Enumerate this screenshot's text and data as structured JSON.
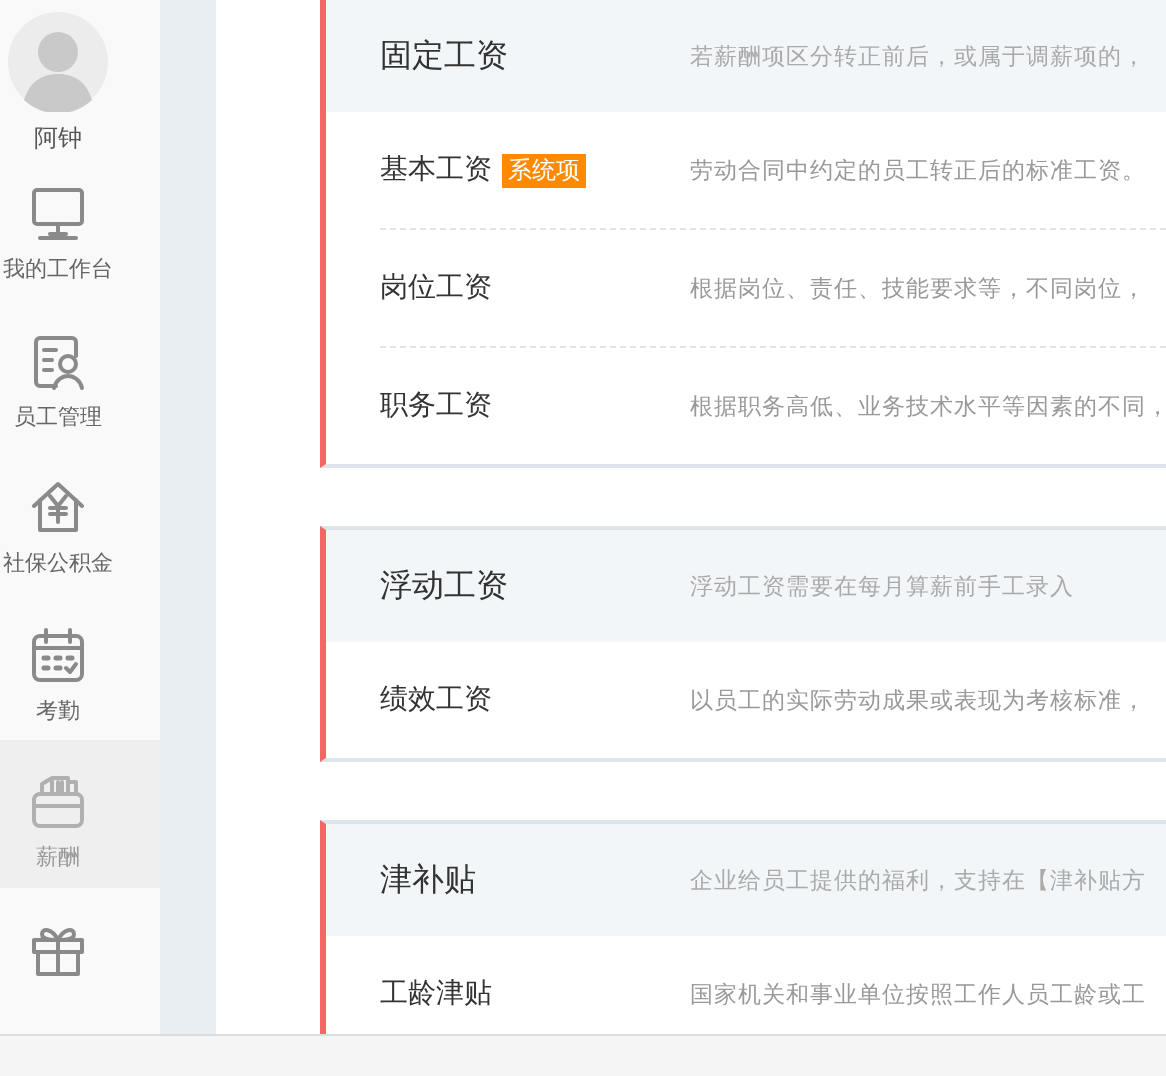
{
  "user": {
    "name": "阿钟"
  },
  "sidebar": {
    "items": [
      {
        "label": "我的工作台",
        "selected": false
      },
      {
        "label": "员工管理",
        "selected": false
      },
      {
        "label": "社保公积金",
        "selected": false
      },
      {
        "label": "考勤",
        "selected": false
      },
      {
        "label": "薪酬",
        "selected": true
      },
      {
        "selected": false
      }
    ]
  },
  "sections": [
    {
      "title": "固定工资",
      "description": "若薪酬项区分转正前后，或属于调薪项的，",
      "items": [
        {
          "name": "基本工资",
          "badge": "系统项",
          "description": "劳动合同中约定的员工转正后的标准工资。"
        },
        {
          "name": "岗位工资",
          "description": "根据岗位、责任、技能要求等，不同岗位，"
        },
        {
          "name": "职务工资",
          "description": "根据职务高低、业务技术水平等因素的不同，"
        }
      ]
    },
    {
      "title": "浮动工资",
      "description": "浮动工资需要在每月算薪前手工录入",
      "items": [
        {
          "name": "绩效工资",
          "description": "以员工的实际劳动成果或表现为考核标准，"
        }
      ]
    },
    {
      "title": "津补贴",
      "description": "企业给员工提供的福利，支持在【津补贴方",
      "items": [
        {
          "name": "工龄津贴",
          "description": "国家机关和事业单位按照工作人员工龄或工"
        }
      ]
    }
  ]
}
